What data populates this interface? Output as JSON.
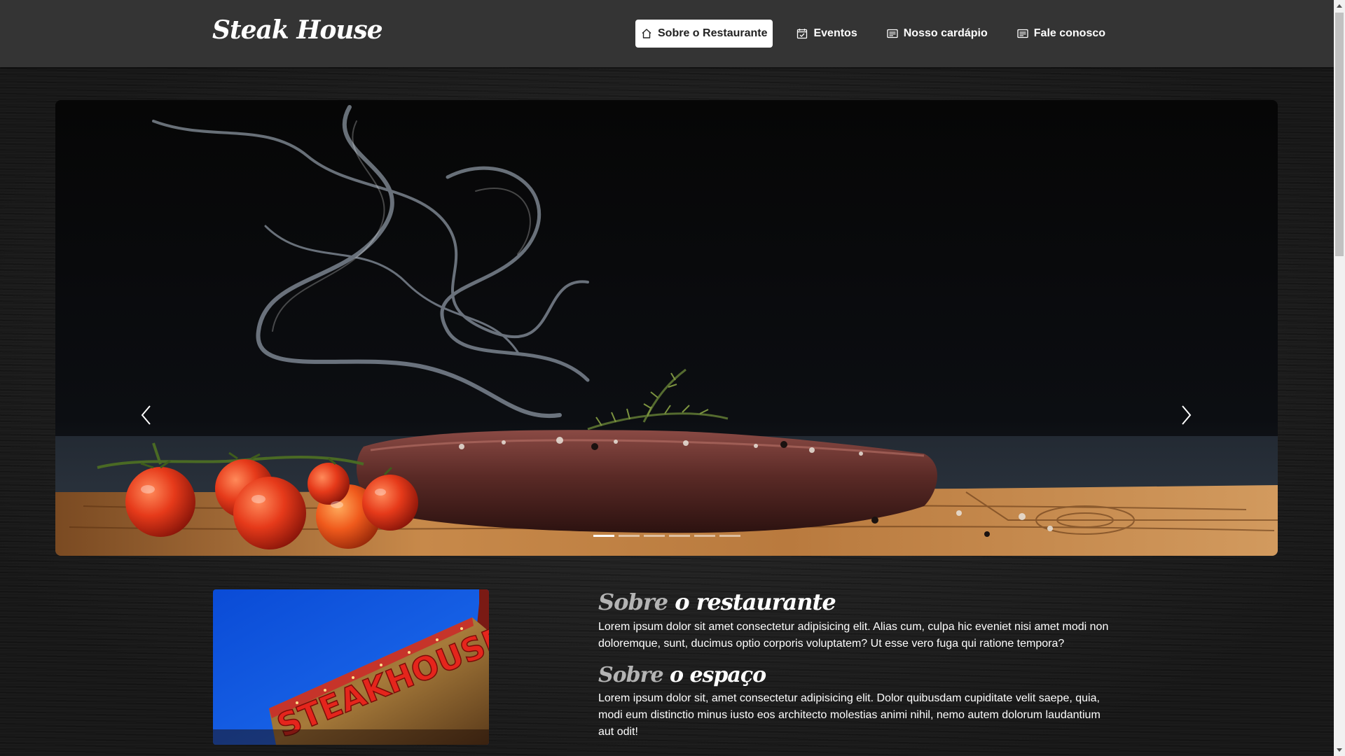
{
  "brand": "Steak House",
  "nav": {
    "items": [
      {
        "label": "Sobre o Restaurante",
        "icon": "home-icon",
        "active": true
      },
      {
        "label": "Eventos",
        "icon": "calendar-check-icon",
        "active": false
      },
      {
        "label": "Nosso cardápio",
        "icon": "menu-card-icon",
        "active": false
      },
      {
        "label": "Fale conosco",
        "icon": "menu-card-icon",
        "active": false
      }
    ]
  },
  "carousel": {
    "slide_count": 6,
    "active_slide": 1,
    "image_subject": "grilled steak with cherry tomatoes and smoke on wooden board"
  },
  "about": {
    "image_sign_text": "STEAKHOUSE",
    "section1": {
      "title_accent": "Sobre",
      "title_rest": "o restaurante",
      "text": "Lorem ipsum dolor sit amet consectetur adipisicing elit. Alias cum, culpa hic eveniet nisi amet modi non doloremque, sunt, ducimus optio corporis voluptatem? Ut esse vero fuga qui ratione tempora?"
    },
    "section2": {
      "title_accent": "Sobre",
      "title_rest": "o espaço",
      "text": "Lorem ipsum dolor sit, amet consectetur adipisicing elit. Dolor quibusdam cupiditate velit saepe, quia, modi eum distinctio minus iusto eos architecto molestias animi nihil, nemo autem dolorum laudantium aut odit!"
    }
  },
  "colors": {
    "navbar": "#343434",
    "page_background": "#1b1b1b",
    "active_nav_background": "#ffffff",
    "title_accent": "#b3b3b3"
  }
}
